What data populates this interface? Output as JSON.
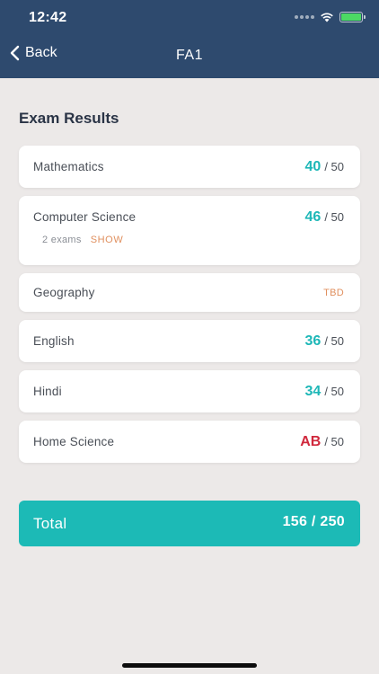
{
  "status": {
    "time": "12:42"
  },
  "nav": {
    "back_label": "Back",
    "title": "FA1"
  },
  "section": {
    "title": "Exam Results"
  },
  "results": [
    {
      "subject": "Mathematics",
      "score": "40",
      "out_of": "/ 50"
    },
    {
      "subject": "Computer Science",
      "score": "46",
      "out_of": "/ 50",
      "exams": "2 exams",
      "show": "SHOW"
    },
    {
      "subject": "Geography",
      "status": "TBD"
    },
    {
      "subject": "English",
      "score": "36",
      "out_of": "/ 50"
    },
    {
      "subject": "Hindi",
      "score": "34",
      "out_of": "/ 50"
    },
    {
      "subject": "Home Science",
      "score": "AB",
      "out_of": "/ 50"
    }
  ],
  "total": {
    "label": "Total",
    "value": "156 / 250"
  },
  "colors": {
    "header": "#2e4a6e",
    "accent": "#1cbab6",
    "absent": "#d0283c",
    "tbd": "#e0905f"
  }
}
